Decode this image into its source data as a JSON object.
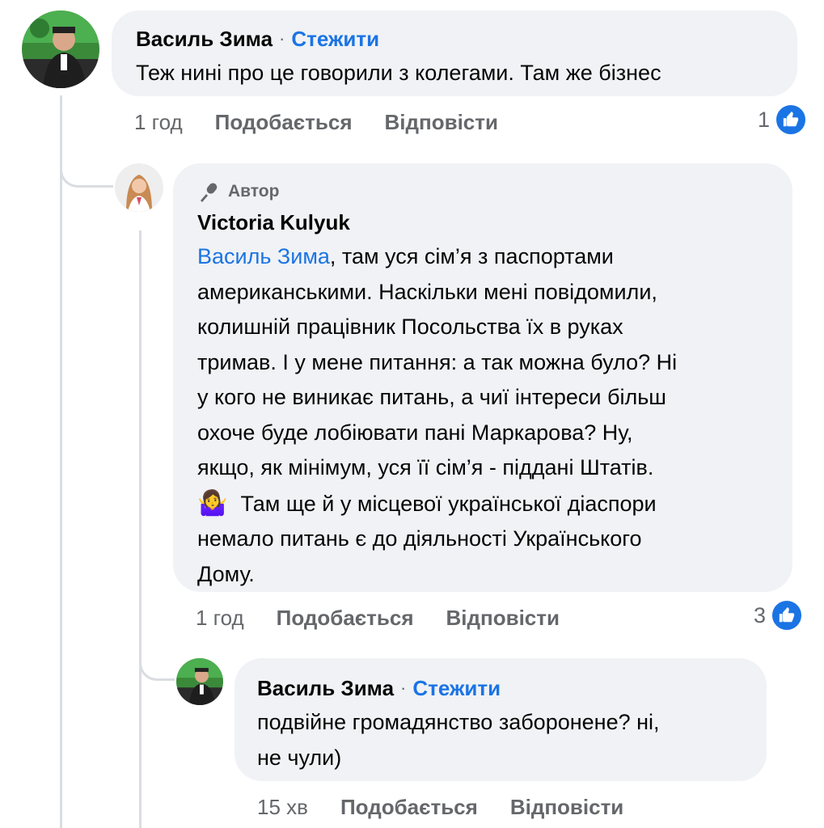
{
  "comment1": {
    "author": "Василь Зима",
    "separator": "·",
    "follow_label": "Стежити",
    "text": "Теж нині про це говорили з колегами. Там же бізнес",
    "time": "1 год",
    "like_label": "Подобається",
    "reply_label": "Відповісти",
    "reaction_count": "1",
    "reaction_icon": "like-icon"
  },
  "reply1": {
    "badge_icon": "microphone-icon",
    "badge_label": "Автор",
    "author": "Victoria Kulyuk",
    "mention": "Василь Зима",
    "lines": [
      ", там уся сім’я з паспортами",
      "американськими. Наскільки мені повідомили,",
      "колишній працівник Посольства їх в руках",
      "тримав. І у мене питання: а так можна було? Ні",
      "у кого не виникає питань, а чиї інтереси більш",
      "охоче буде лобіювати пані Маркарова? Ну,",
      "якщо, як мінімум, уся її сім’я - піддані Штатів.",
      " Там ще й у місцевої української діаспори",
      "немало питань є до діяльності Українського",
      "Дому."
    ],
    "emoji": "🤷‍♀️",
    "time": "1 год",
    "like_label": "Подобається",
    "reply_label": "Відповісти",
    "reaction_count": "3",
    "reaction_icon": "like-icon"
  },
  "reply2": {
    "author": "Василь Зима",
    "separator": "·",
    "follow_label": "Стежити",
    "lines": [
      "подвійне громадянство заборонене? ні,",
      "не чули)"
    ],
    "time": "15 хв",
    "like_label": "Подобається",
    "reply_label": "Відповісти"
  },
  "colors": {
    "bubble": "#f0f2f5",
    "link": "#1b74e4",
    "muted": "#65676b",
    "like": "#1b74e4"
  }
}
